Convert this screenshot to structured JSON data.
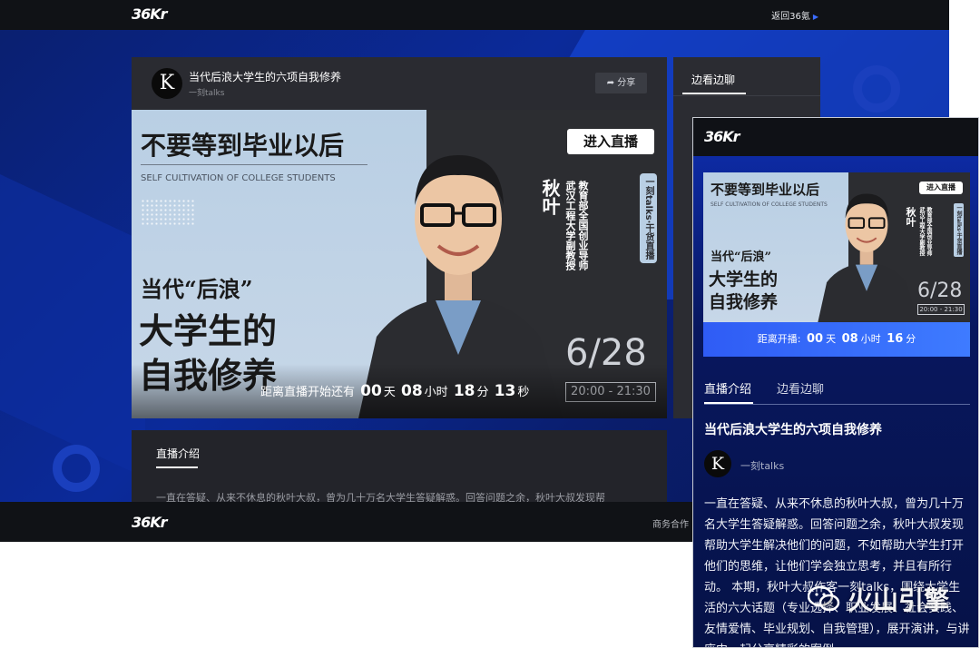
{
  "desktop": {
    "logo": "36Kr",
    "back_link": "返回36氪",
    "video": {
      "title": "当代后浪大学生的六项自我修养",
      "author": "一刻talks",
      "share_label": "分享",
      "countdown_prefix": "距离直播开始还有",
      "countdown": {
        "days": "00",
        "day_unit": "天",
        "hours": "08",
        "hour_unit": "小时",
        "minutes": "18",
        "minute_unit": "分",
        "seconds": "13",
        "second_unit": "秒"
      }
    },
    "side": {
      "tab": "边看边聊"
    },
    "intro": {
      "tab": "直播介绍",
      "text": "一直在答疑、从来不休息的秋叶大叔，曾为几十万名大学生答疑解惑。回答问题之余，秋叶大叔发现帮"
    },
    "footer": {
      "logo": "36Kr",
      "link": "商务合作"
    }
  },
  "poster": {
    "headline": "不要等到毕业以后",
    "subline": "SELF CULTIVATION OF COLLEGE STUDENTS",
    "tag": "当代“后浪”",
    "title_line1": "大学生的",
    "title_line2": "自我修养",
    "speaker_name": "秋叶",
    "speaker_title1": "武汉工程大学副教授",
    "speaker_title2": "教育部全国创业导师",
    "badge": "一刻talks·干货直播",
    "enter_label": "进入直播",
    "date": "6/28",
    "time": "20:00 - 21:30"
  },
  "mobile": {
    "logo": "36Kr",
    "countdown_prefix": "距离开播:",
    "countdown": {
      "days": "00",
      "day_unit": "天",
      "hours": "08",
      "hour_unit": "小时",
      "minutes": "16",
      "minute_unit": "分"
    },
    "tabs": [
      "直播介绍",
      "边看边聊"
    ],
    "title": "当代后浪大学生的六项自我修养",
    "author": "一刻talks",
    "text": "一直在答疑、从来不休息的秋叶大叔，曾为几十万名大学生答疑解惑。回答问题之余，秋叶大叔发现帮助大学生解决他们的问题，不如帮助大学生打开他们的思维，让他们学会独立思考，并且有所行动。 本期，秋叶大叔作客一刻talks，围绕大学生活的六大话题（专业选择、职业发展、社会实践、友情爱情、毕业规划、自我管理），展开演讲，与讲座中一起分享精彩的案例"
  },
  "watermark": "火山引擎",
  "colors": {
    "accent": "#3b6cff",
    "dark": "#101216",
    "panel": "#2a2b31"
  }
}
